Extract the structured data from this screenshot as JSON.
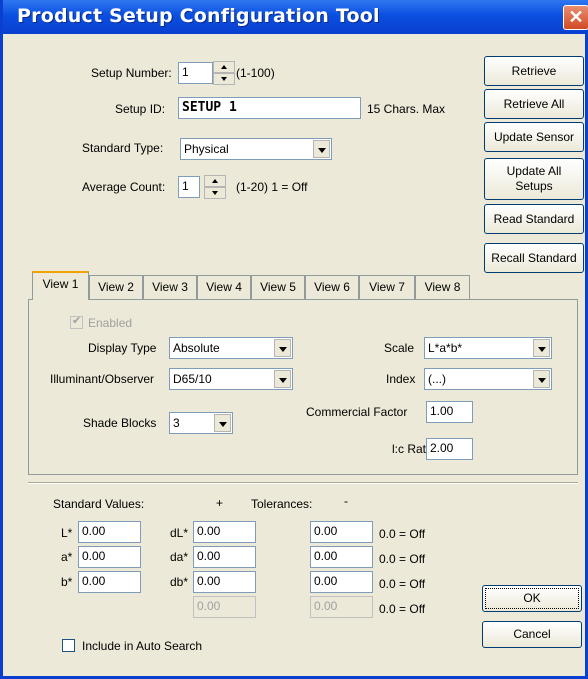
{
  "window": {
    "title": "Product Setup Configuration Tool",
    "close_glyph": "✕"
  },
  "setup": {
    "number_label": "Setup Number:",
    "number_value": "1",
    "number_hint": "(1-100)",
    "id_label": "Setup ID:",
    "id_value": "SETUP 1",
    "id_hint": "15 Chars. Max",
    "standard_type_label": "Standard Type:",
    "standard_type_value": "Physical",
    "average_count_label": "Average Count:",
    "average_count_value": "1",
    "average_count_hint": "(1-20) 1 = Off"
  },
  "side_buttons": {
    "retrieve": "Retrieve",
    "retrieve_all": "Retrieve All",
    "update_sensor": "Update Sensor",
    "update_all_line1": "Update All",
    "update_all_line2": "Setups",
    "read_standard": "Read Standard",
    "recall_standard": "Recall Standard"
  },
  "tabs": [
    "View 1",
    "View 2",
    "View 3",
    "View 4",
    "View 5",
    "View 6",
    "View 7",
    "View 8"
  ],
  "view": {
    "enabled_label": "Enabled",
    "display_type_label": "Display Type",
    "display_type_value": "Absolute",
    "illuminant_label": "Illuminant/Observer",
    "illuminant_value": "D65/10",
    "shade_blocks_label": "Shade Blocks",
    "shade_blocks_value": "3",
    "scale_label": "Scale",
    "scale_value": "L*a*b*",
    "index_label": "Index",
    "index_value": "(...)",
    "commercial_factor_label": "Commercial Factor",
    "commercial_factor_value": "1.00",
    "lc_ratio_label": "l:c Ratio",
    "lc_ratio_value": "2.00"
  },
  "standards": {
    "header_label": "Standard Values:",
    "plus": "+",
    "tolerances_label": "Tolerances:",
    "minus": "-",
    "rows": [
      {
        "std_label": "L*",
        "std_value": "0.00",
        "tol_label": "dL*",
        "plus_value": "0.00",
        "minus_value": "0.00",
        "off_label": "0.0 = Off"
      },
      {
        "std_label": "a*",
        "std_value": "0.00",
        "tol_label": "da*",
        "plus_value": "0.00",
        "minus_value": "0.00",
        "off_label": "0.0 = Off"
      },
      {
        "std_label": "b*",
        "std_value": "0.00",
        "tol_label": "db*",
        "plus_value": "0.00",
        "minus_value": "0.00",
        "off_label": "0.0 = Off"
      },
      {
        "plus_value": "0.00",
        "minus_value": "0.00",
        "off_label": "0.0 = Off"
      }
    ],
    "include_auto_search_label": "Include in Auto Search"
  },
  "footer_buttons": {
    "ok": "OK",
    "cancel": "Cancel"
  }
}
